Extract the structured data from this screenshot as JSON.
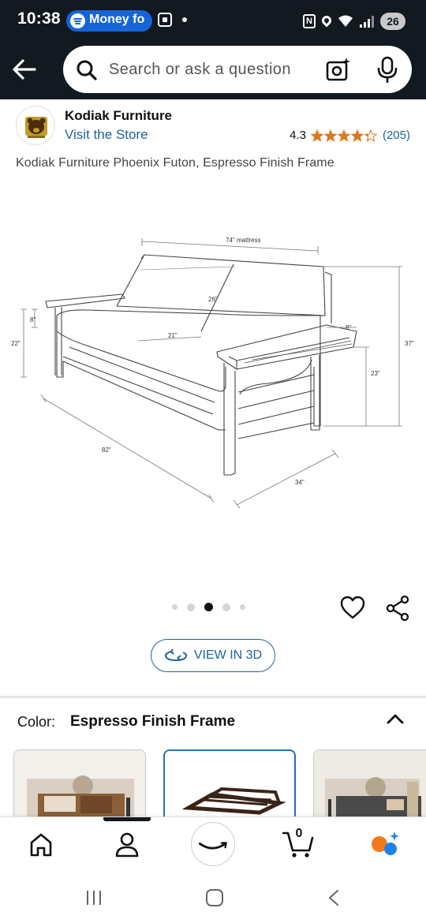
{
  "status_bar": {
    "time": "10:38",
    "notification_pill": "Money fo",
    "battery": "26"
  },
  "search": {
    "placeholder": "Search or ask a question"
  },
  "store": {
    "name": "Kodiak Furniture",
    "visit_link": "Visit the Store",
    "rating": "4.3",
    "rating_value": 4.3,
    "review_count": "(205)"
  },
  "product": {
    "title": "Kodiak Furniture Phoenix Futon, Espresso Finish Frame",
    "dimensions": {
      "mattress": "74\" mattress",
      "back": "26\"",
      "seat_depth": "21\"",
      "arm_thickness": "8\"",
      "arm_height_left": "22\"",
      "arm_width": "8\"",
      "total_height": "37\"",
      "seat_height": "23\"",
      "total_width": "82\"",
      "total_depth": "34\""
    }
  },
  "carousel": {
    "total": 5,
    "active_index": 2
  },
  "view_3d_label": "VIEW IN 3D",
  "color": {
    "label": "Color:",
    "value": "Espresso Finish Frame"
  },
  "bottom_nav": {
    "cart_count": "0"
  },
  "colors": {
    "dark_header": "#131921",
    "link_blue": "#2162a1",
    "star_orange": "#de7921",
    "spotify_pill": "#1565d8"
  }
}
